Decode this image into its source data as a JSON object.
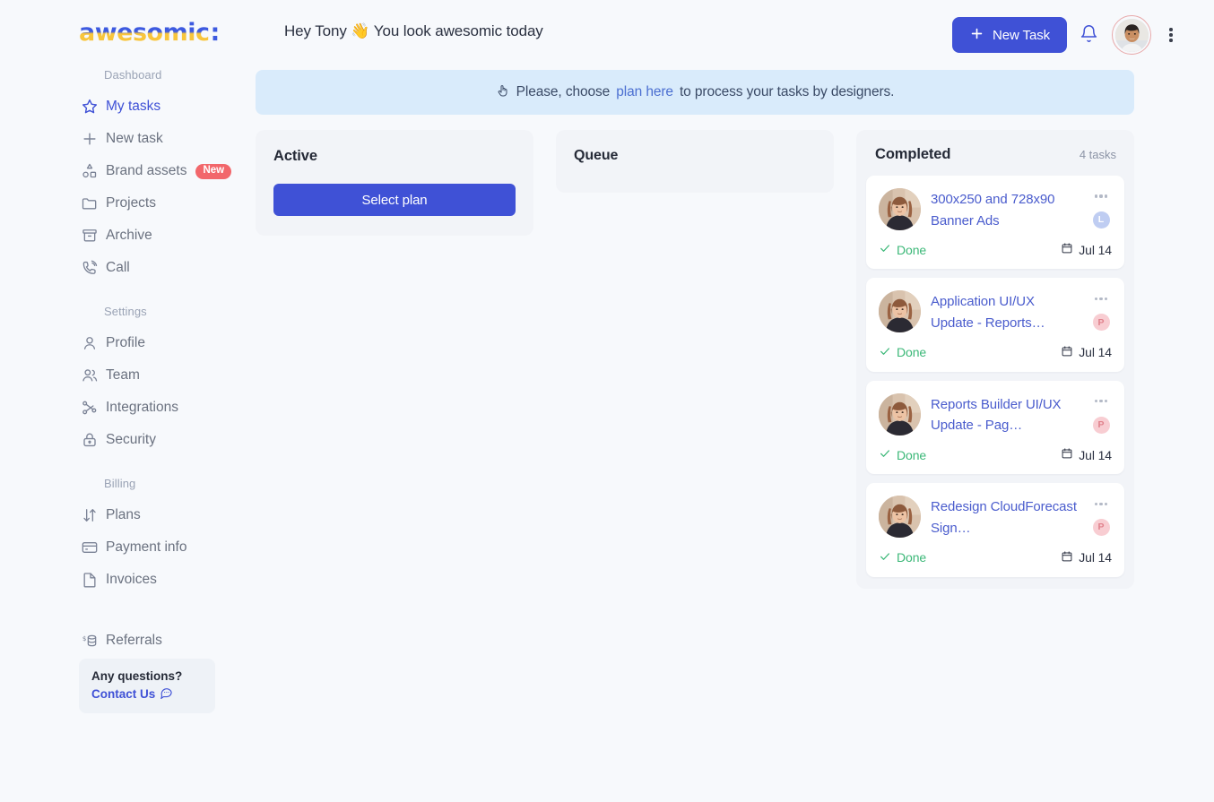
{
  "brand": {
    "logo_text": "awesomic",
    "logo_suffix": ":",
    "accent_blue": "#3f51d6",
    "accent_yellow": "#f8c53c"
  },
  "header": {
    "greeting_prefix": "Hey Tony",
    "greeting_emoji": "👋",
    "greeting_suffix": "You look awesomic today",
    "new_task_label": "New Task",
    "plus_icon": "plus-icon",
    "bell_icon": "bell-icon",
    "avatar_icon": "user-avatar",
    "kebab_icon": "kebab-menu-icon"
  },
  "banner": {
    "hand_icon": "pointing-hand-icon",
    "text_before": "Please, choose",
    "link_text": "plan here",
    "text_after": "to process your tasks by designers.",
    "background": "#d9ebfb",
    "link_color": "#4b6fd1"
  },
  "sidebar": {
    "groups": [
      {
        "title": "Dashboard",
        "items": [
          {
            "label": "My tasks",
            "icon": "star-icon",
            "active": true
          },
          {
            "label": "New task",
            "icon": "plus-icon",
            "active": false
          },
          {
            "label": "Brand assets",
            "icon": "brand-assets-icon",
            "active": false,
            "badge": "New"
          },
          {
            "label": "Projects",
            "icon": "folder-icon",
            "active": false
          },
          {
            "label": "Archive",
            "icon": "archive-icon",
            "active": false
          },
          {
            "label": "Call",
            "icon": "phone-call-icon",
            "active": false
          }
        ]
      },
      {
        "title": "Settings",
        "items": [
          {
            "label": "Profile",
            "icon": "user-icon",
            "active": false
          },
          {
            "label": "Team",
            "icon": "users-icon",
            "active": false
          },
          {
            "label": "Integrations",
            "icon": "integrations-icon",
            "active": false
          },
          {
            "label": "Security",
            "icon": "lock-icon",
            "active": false
          }
        ]
      },
      {
        "title": "Billing",
        "items": [
          {
            "label": "Plans",
            "icon": "arrows-updown-icon",
            "active": false
          },
          {
            "label": "Payment info",
            "icon": "credit-card-icon",
            "active": false
          },
          {
            "label": "Invoices",
            "icon": "document-icon",
            "active": false
          }
        ]
      },
      {
        "title": "",
        "items": [
          {
            "label": "Referrals",
            "icon": "referrals-coins-icon",
            "active": false
          }
        ]
      }
    ],
    "help": {
      "title": "Any questions?",
      "link": "Contact Us",
      "chat_icon": "chat-bubble-icon"
    }
  },
  "board": {
    "active": {
      "title": "Active",
      "button_label": "Select plan"
    },
    "queue": {
      "title": "Queue"
    },
    "completed": {
      "title": "Completed",
      "count_label": "4 tasks",
      "tasks": [
        {
          "title": "300x250 and 728x90 Banner Ads",
          "status": "Done",
          "date": "Jul 14",
          "chip": "L",
          "chip_style": "lilac",
          "menu_icon": "more-options-icon",
          "check_icon": "check-icon",
          "calendar_icon": "calendar-icon",
          "avatar_icon": "designer-avatar"
        },
        {
          "title": "Application UI/UX Update - Reports…",
          "status": "Done",
          "date": "Jul 14",
          "chip": "P",
          "chip_style": "pink",
          "menu_icon": "more-options-icon",
          "check_icon": "check-icon",
          "calendar_icon": "calendar-icon",
          "avatar_icon": "designer-avatar"
        },
        {
          "title": "Reports Builder UI/UX Update - Pag…",
          "status": "Done",
          "date": "Jul 14",
          "chip": "P",
          "chip_style": "pink",
          "menu_icon": "more-options-icon",
          "check_icon": "check-icon",
          "calendar_icon": "calendar-icon",
          "avatar_icon": "designer-avatar"
        },
        {
          "title": "Redesign CloudForecast Sign…",
          "status": "Done",
          "date": "Jul 14",
          "chip": "P",
          "chip_style": "pink",
          "menu_icon": "more-options-icon",
          "check_icon": "check-icon",
          "calendar_icon": "calendar-icon",
          "avatar_icon": "designer-avatar"
        }
      ]
    }
  }
}
